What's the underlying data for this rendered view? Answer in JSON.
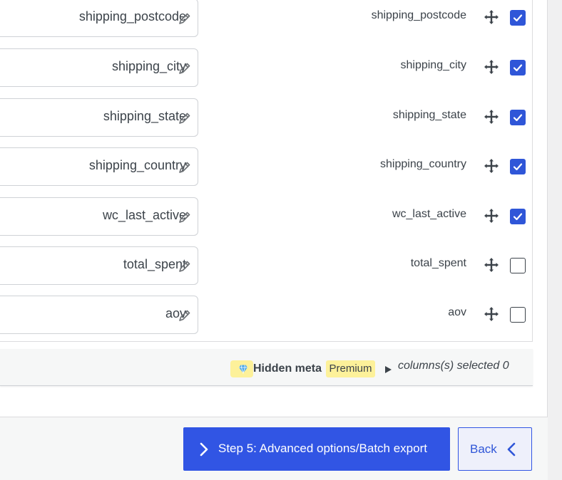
{
  "fields": [
    {
      "value": "shipping_postcode",
      "label": "shipping_postcode",
      "checked": true
    },
    {
      "value": "shipping_city",
      "label": "shipping_city",
      "checked": true
    },
    {
      "value": "shipping_state",
      "label": "shipping_state",
      "checked": true
    },
    {
      "value": "shipping_country",
      "label": "shipping_country",
      "checked": true
    },
    {
      "value": "wc_last_active",
      "label": "wc_last_active",
      "checked": true
    },
    {
      "value": "total_spent",
      "label": "total_spent",
      "checked": false
    },
    {
      "value": "aov",
      "label": "aov",
      "checked": false
    }
  ],
  "hidden_meta": {
    "title": "Hidden meta",
    "badge": "Premium",
    "selected_text": "columns(s) selected 0"
  },
  "buttons": {
    "next_label": "Step 5: Advanced options/Batch export",
    "back_label": "Back"
  },
  "colors": {
    "accent": "#3155e4",
    "badge": "#fdf19a",
    "text": "#3c434a"
  },
  "icons": {
    "edit": "pencil-icon",
    "move": "move-icon",
    "premium": "diamond-icon",
    "expand": "triangle-right-icon",
    "next": "chevron-right-icon",
    "back": "chevron-left-icon"
  }
}
